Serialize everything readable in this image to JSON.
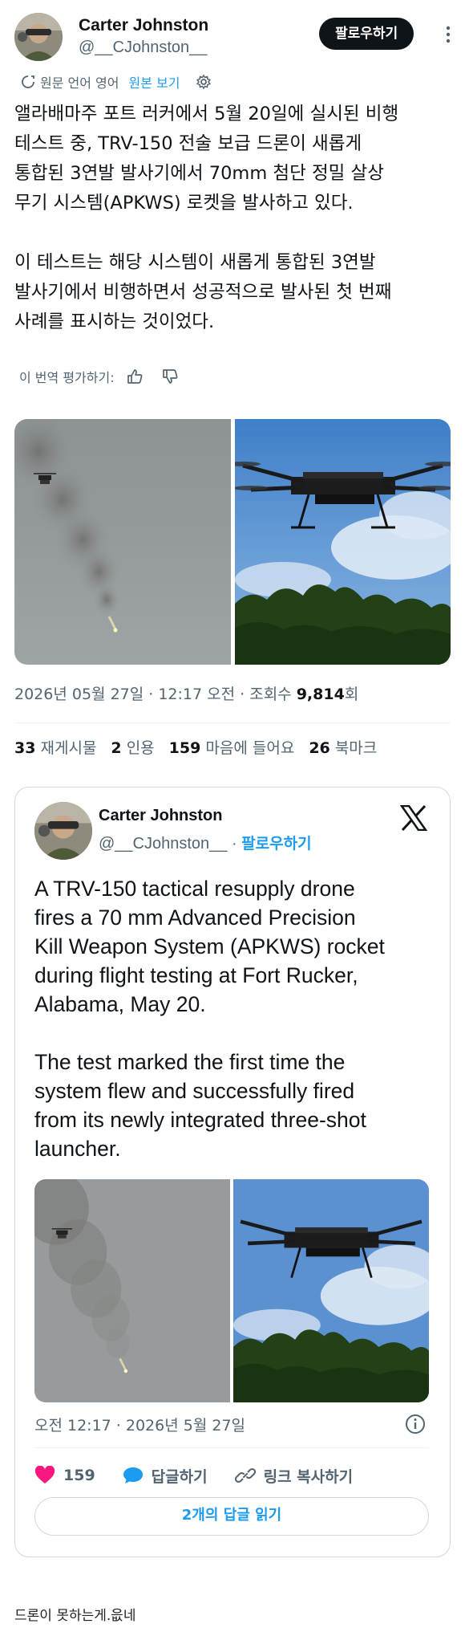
{
  "author": {
    "name": "Carter Johnston",
    "handle": "@__CJohnston__",
    "follow_label": "팔로우하기"
  },
  "translation": {
    "label": "원문 언어 영어",
    "show_original": "원본 보기"
  },
  "tweet": {
    "text": "앨라배마주 포트 러커에서 5월 20일에 실시된 비행\n테스트 중, TRV-150 전술 보급 드론이 새롭게\n통합된 3연발 발사기에서 70mm 첨단 정밀 살상\n무기 시스템(APKWS) 로켓을 발사하고 있다.\n\n이 테스트는 해당 시스템이 새롭게 통합된 3연발\n발사기에서 비행하면서 성공적으로 발사된 첫 번째\n사례를 표시하는 것이었다.",
    "rate_label": "이 번역 평가하기:",
    "meta_prefix": "2026년 05월 27일 · 12:17 오전 · 조회수 ",
    "views": "9,814",
    "views_suffix": "회"
  },
  "stats": {
    "retweets": "33",
    "retweets_label": "재게시물",
    "quotes": "2",
    "quotes_label": "인용",
    "likes": "159",
    "likes_label": "마음에 들어요",
    "bookmarks": "26",
    "bookmarks_label": "북마크"
  },
  "quote": {
    "name": "Carter Johnston",
    "handle": "@__CJohnston__",
    "separator": " · ",
    "follow_label": "팔로우하기",
    "text": "A TRV-150 tactical resupply drone\nfires a 70 mm Advanced Precision\nKill Weapon System (APKWS) rocket\nduring flight testing at Fort Rucker,\nAlabama, May 20.\n\nThe test marked the first time the\nsystem flew and successfully fired\nfrom its newly integrated three-shot\nlauncher.",
    "time": "오전 12:17 · 2026년 5월 27일",
    "like_count": "159",
    "reply_label": "답글하기",
    "copy_label": "링크 복사하기",
    "read_replies": "2개의 답글 읽기"
  },
  "comment": "드론이 못하는게.읎네",
  "colors": {
    "accent": "#1d9bf0",
    "like": "#f91880",
    "text": "#0f1419",
    "muted": "#536471"
  },
  "icons": [
    "more-icon",
    "translate-icon",
    "gear-icon",
    "thumbs-up-icon",
    "thumbs-down-icon",
    "x-logo-icon",
    "info-icon",
    "heart-icon",
    "reply-icon",
    "link-icon"
  ]
}
